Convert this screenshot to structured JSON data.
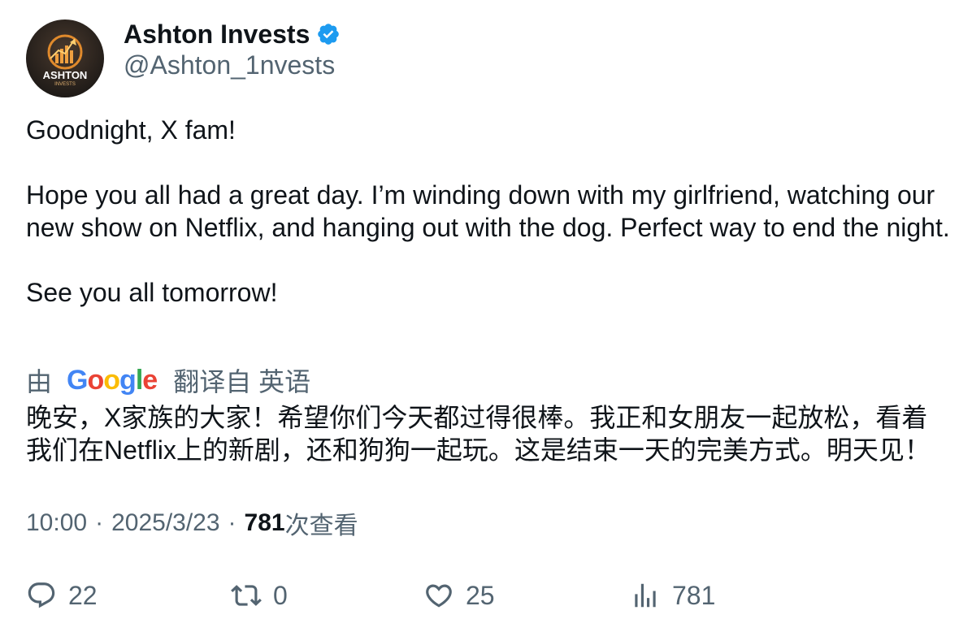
{
  "author": {
    "display_name": "Ashton Invests",
    "handle": "@Ashton_1nvests",
    "verified": true,
    "avatar_text": "ASHTON",
    "avatar_subtext": "INVESTS"
  },
  "tweet": {
    "paragraphs": [
      "Goodnight, X fam!",
      "Hope you all had a great day. I’m winding down with my girlfriend, watching our new show on Netflix, and hanging out with the dog. Perfect way to end the night.",
      "See you all tomorrow!"
    ]
  },
  "translation": {
    "prefix": "由",
    "brand": "Google",
    "suffix": "翻译自 英语",
    "text": "晚安，X家族的大家！希望你们今天都过得很棒。我正和女朋友一起放松，看着我们在Netflix上的新剧，还和狗狗一起玩。这是结束一天的完美方式。明天见！"
  },
  "meta": {
    "time": "10:00",
    "separator": "·",
    "date": "2025/3/23",
    "views_count": "781",
    "views_label": "次查看"
  },
  "actions": {
    "replies": "22",
    "reposts": "0",
    "likes": "25",
    "views": "781"
  },
  "colors": {
    "text": "#0f1419",
    "secondary": "#536471",
    "verified": "#1d9bf0"
  }
}
